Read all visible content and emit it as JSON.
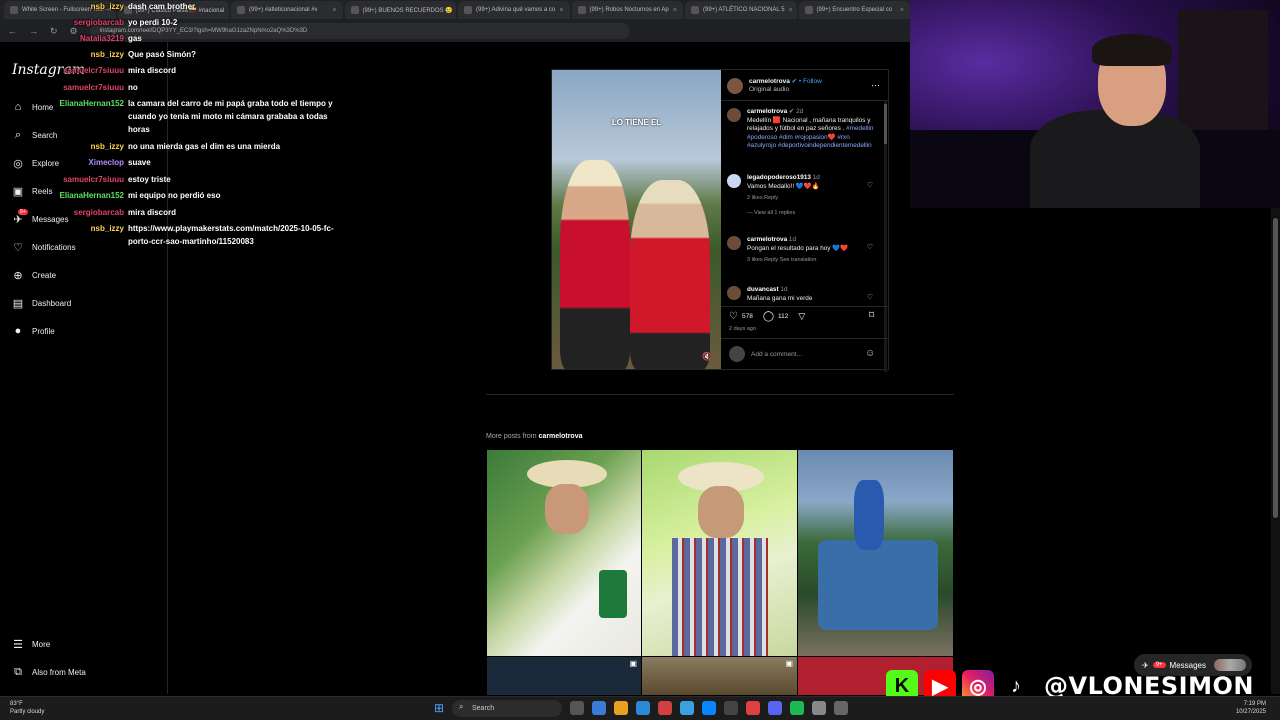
{
  "browser": {
    "tabs": [
      "White Screen - Fullscreen Tool",
      "(99+) Clásico Paisa 🇨🇴 #nacional",
      "(99+) #atleticonacional #v",
      "(99+) BUENOS RECUERDOS 😢",
      "(99+) Adivina qué vamos a co",
      "(99+) Robos Nocturnos en Ap",
      "(99+) ATLÉTICO NACIONAL 5",
      "(99+) Encuentro Especial co"
    ],
    "url": "instagram.com/reel/DQP3YY_EC3/?igsh=MW9haG1za2NpNmo2aQ%3D%3D"
  },
  "sidebar": {
    "logo": "Instagram",
    "items": [
      {
        "label": "Home",
        "icon": "home-icon",
        "glyph": "⌂"
      },
      {
        "label": "Search",
        "icon": "search-icon",
        "glyph": "⌕"
      },
      {
        "label": "Explore",
        "icon": "compass-icon",
        "glyph": "◎"
      },
      {
        "label": "Reels",
        "icon": "reels-icon",
        "glyph": "▣"
      },
      {
        "label": "Messages",
        "icon": "messenger-icon",
        "glyph": "✈"
      },
      {
        "label": "Notifications",
        "icon": "heart-icon",
        "glyph": "♡"
      },
      {
        "label": "Create",
        "icon": "plus-icon",
        "glyph": "⊕"
      },
      {
        "label": "Dashboard",
        "icon": "dashboard-icon",
        "glyph": "▤"
      },
      {
        "label": "Profile",
        "icon": "avatar-icon",
        "glyph": "●"
      }
    ],
    "more": "More",
    "also_from_meta": "Also from Meta",
    "messages_badge": "9+"
  },
  "chat": [
    {
      "user": "nsb_izzy",
      "color": "#ffd24a",
      "text": "dash cam brother"
    },
    {
      "user": "sergiobarcab",
      "color": "#e0446a",
      "text": "yo perdi 10-2"
    },
    {
      "user": "Natalia3219",
      "color": "#e0446a",
      "text": "gas"
    },
    {
      "user": "nsb_izzy",
      "color": "#ffd24a",
      "text": "Que pasó Simón?"
    },
    {
      "user": "samuelcr7siuuu",
      "color": "#e0446a",
      "text": "mira discord"
    },
    {
      "user": "samuelcr7siuuu",
      "color": "#e0446a",
      "text": "no"
    },
    {
      "user": "ElianaHernan152",
      "color": "#5fe05f",
      "text": "la camara del carro de mi papá graba todo el tiempo y cuando yo tenía mi moto mi cámara grababa a todas horas"
    },
    {
      "user": "nsb_izzy",
      "color": "#ffd24a",
      "text": "no una mierda gas el dim es una mierda"
    },
    {
      "user": "Ximeclop",
      "color": "#b48cff",
      "text": "suave"
    },
    {
      "user": "samuelcr7siuuu",
      "color": "#e0446a",
      "text": "estoy triste"
    },
    {
      "user": "ElianaHernan152",
      "color": "#5fe05f",
      "text": "mi equipo no perdió eso"
    },
    {
      "user": "sergiobarcab",
      "color": "#e0446a",
      "text": "mira discord"
    },
    {
      "user": "nsb_izzy",
      "color": "#ffd24a",
      "text": "https://www.playmakerstats.com/match/2025-10-05-fc-porto-ccr-sao-martinho/11520083"
    }
  ],
  "post": {
    "overlay_text": "LO TIENE EL",
    "author": "carmelotrova",
    "follow": "Follow",
    "audio": "Original audio",
    "caption_author": "carmelotrova",
    "caption_time": "2d",
    "caption_text": "Medellín 🟥 Nacional , mañana tranquilos y relajados y fútbol en paz señores .",
    "caption_tags": "#medellin #poderoso #dim #rojopasion❤️ #rxn #azulyrojo #deportivoindependientemedellin",
    "comments": [
      {
        "user": "legadopoderoso1913",
        "time": "1d",
        "text": "Vamos Medallo!! 💙❤️🔥",
        "meta": "2 likes   Reply",
        "extra": "View all 1 replies"
      },
      {
        "user": "carmelotrova",
        "time": "1d",
        "text": "Pongan el resultado para hoy 💙❤️",
        "meta": "3 likes   Reply   See translation",
        "extra": ""
      },
      {
        "user": "duvancast",
        "time": "1d",
        "text": "Mañana gana mi verde",
        "meta": "",
        "extra": ""
      }
    ],
    "likes": "578",
    "comments_count": "112",
    "age": "2 days ago",
    "add_comment": "Add a comment…"
  },
  "more_posts": {
    "prefix": "More posts from",
    "author": "carmelotrova"
  },
  "overlay": {
    "messages": "Messages",
    "messages_badge": "9+",
    "handle": "@VLONESIMON"
  },
  "taskbar": {
    "temp": "83°F",
    "weather": "Partly cloudy",
    "search": "Search",
    "time": "7:19 PM",
    "date": "10/27/2025"
  }
}
